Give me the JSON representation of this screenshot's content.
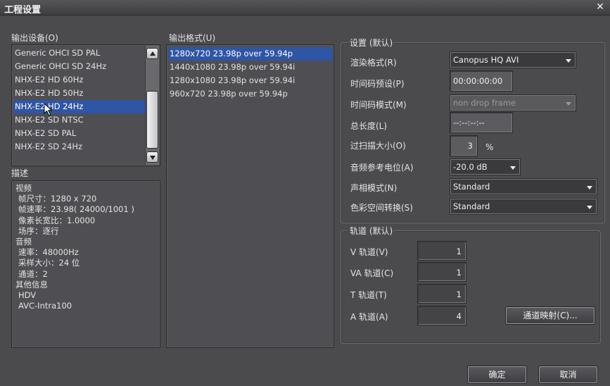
{
  "window": {
    "title": "工程设置",
    "close_glyph": "✕"
  },
  "output_device": {
    "label": "输出设备(O)",
    "items": [
      {
        "label": "Generic OHCI SD PAL",
        "selected": false
      },
      {
        "label": "Generic OHCI SD 24Hz",
        "selected": false
      },
      {
        "label": "NHX-E2 HD 60Hz",
        "selected": false
      },
      {
        "label": "NHX-E2 HD 50Hz",
        "selected": false
      },
      {
        "label": "NHX-E2 HD 24Hz",
        "selected": true
      },
      {
        "label": "NHX-E2 SD NTSC",
        "selected": false
      },
      {
        "label": "NHX-E2 SD PAL",
        "selected": false
      },
      {
        "label": "NHX-E2 SD 24Hz",
        "selected": false
      }
    ]
  },
  "output_format": {
    "label": "输出格式(U)",
    "items": [
      {
        "label": "1280x720 23.98p over 59.94p",
        "selected": true
      },
      {
        "label": "1440x1080 23.98p over 59.94i",
        "selected": false
      },
      {
        "label": "1280x1080 23.98p over 59.94i",
        "selected": false
      },
      {
        "label": "960x720 23.98p over 59.94p",
        "selected": false
      }
    ]
  },
  "description": {
    "label": "描述",
    "lines": [
      "视频",
      " 帧尺寸：1280 x 720",
      " 帧速率：23.98( 24000/1001 )",
      " 像素长宽比：1.0000",
      " 场序：逐行",
      "音频",
      " 速率：48000Hz",
      " 采样大小：24 位",
      " 通道：2",
      "其他信息",
      " HDV",
      " AVC-Intra100"
    ]
  },
  "settings": {
    "group_title": "设置 (默认)",
    "render_format": {
      "label": "渲染格式(R)",
      "value": "Canopus HQ AVI"
    },
    "timecode_preset": {
      "label": "时间码预设(P)",
      "value": "00:00:00:00"
    },
    "timecode_mode": {
      "label": "时间码模式(M)",
      "value": "non drop frame"
    },
    "total_length": {
      "label": "总长度(L)",
      "value": "--:--:--:--"
    },
    "overscan": {
      "label": "过扫描大小(O)",
      "value": "3",
      "unit": "%"
    },
    "audio_ref": {
      "label": "音频参考电位(A)",
      "value": "-20.0 dB"
    },
    "pan_mode": {
      "label": "声相模式(N)",
      "value": "Standard"
    },
    "color_space": {
      "label": "色彩空间转换(S)",
      "value": "Standard"
    }
  },
  "tracks": {
    "group_title": "轨道 (默认)",
    "v": {
      "label": "V 轨道(V)",
      "value": "1"
    },
    "va": {
      "label": "VA 轨道(C)",
      "value": "1"
    },
    "t": {
      "label": "T 轨道(T)",
      "value": "1"
    },
    "a": {
      "label": "A 轨道(A)",
      "value": "4"
    },
    "mapping_button": "通道映射(C)..."
  },
  "footer": {
    "ok": "确定",
    "cancel": "取消"
  }
}
